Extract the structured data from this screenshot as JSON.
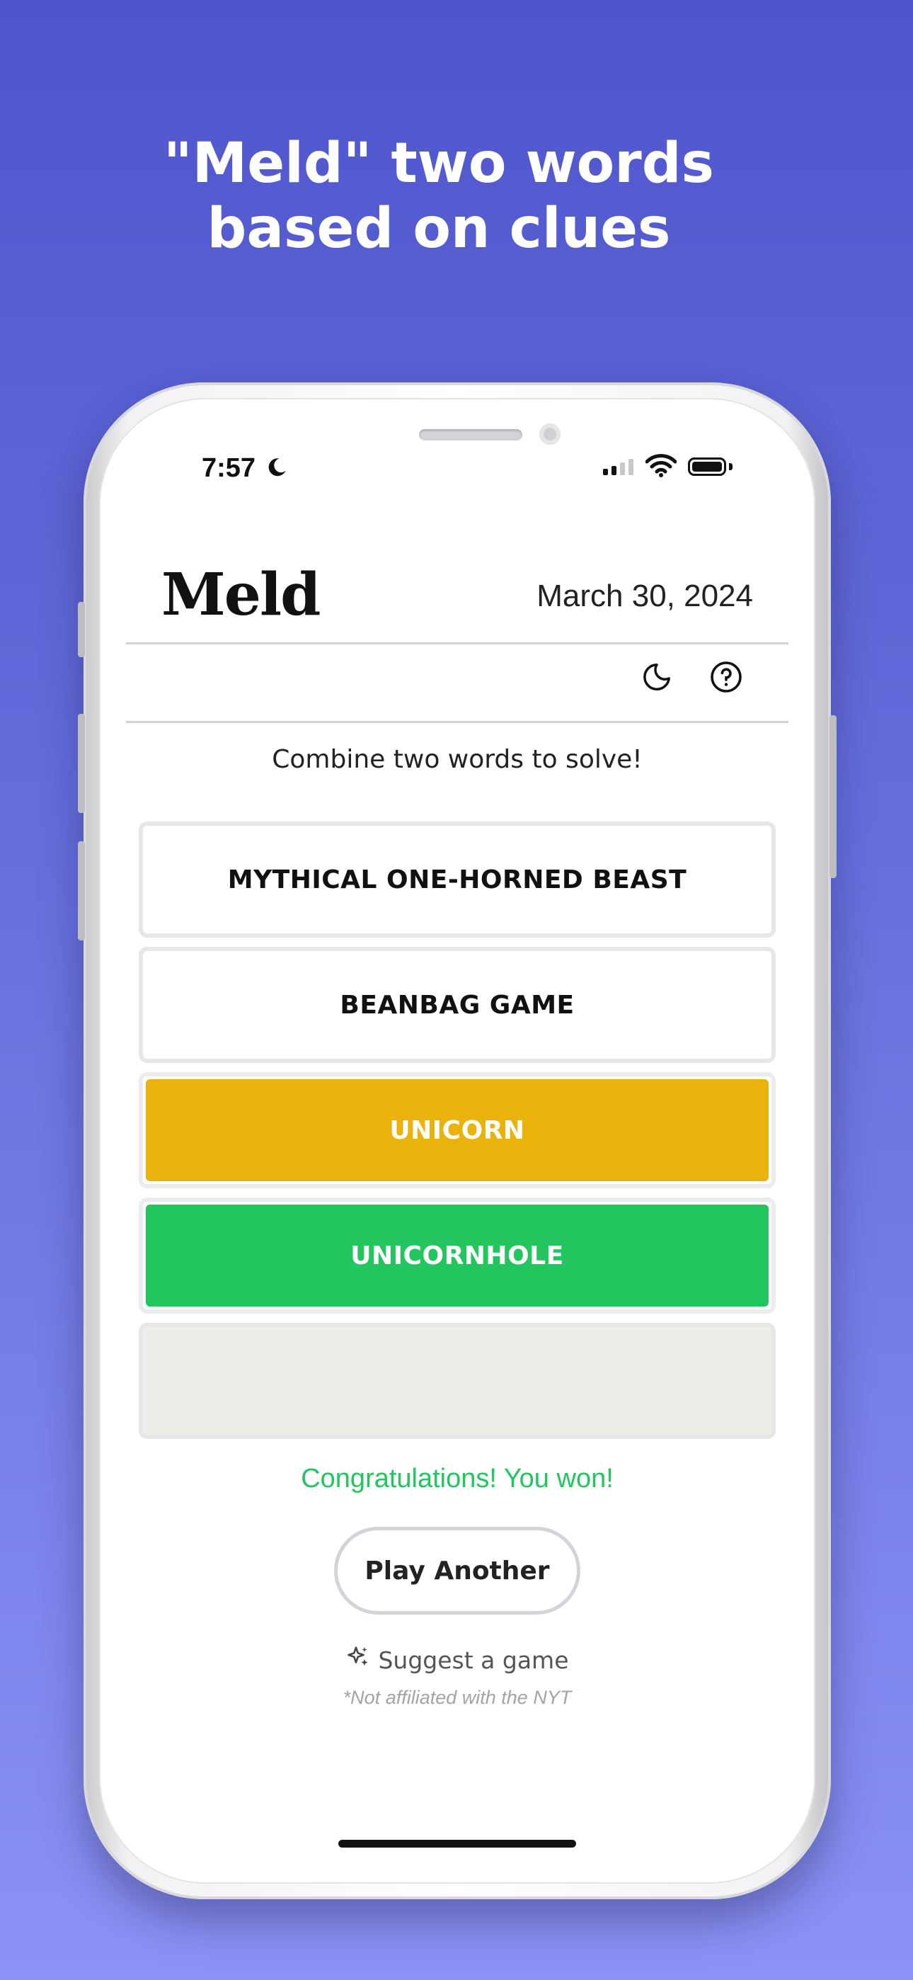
{
  "headline": {
    "line1": "\"Meld\" two words",
    "line2": "based on clues"
  },
  "status_bar": {
    "time": "7:57",
    "focus_icon": "moon-icon",
    "signal_icon": "cellular-signal-icon",
    "wifi_icon": "wifi-icon",
    "battery_icon": "battery-icon"
  },
  "app": {
    "logo": "Meld",
    "date": "March 30, 2024",
    "toolbar": {
      "dark_mode_icon": "moon-icon",
      "help_icon": "help-circle-icon"
    },
    "instruction": "Combine two words to solve!",
    "tiles": [
      {
        "text": "MYTHICAL ONE-HORNED BEAST",
        "state": "clue"
      },
      {
        "text": "BEANBAG GAME",
        "state": "clue"
      },
      {
        "text": "UNICORN",
        "state": "word",
        "color": "#e9b30c"
      },
      {
        "text": "UNICORNHOLE",
        "state": "solved",
        "color": "#22c55e"
      },
      {
        "text": "",
        "state": "empty",
        "color": "#eeede7"
      }
    ],
    "result_message": "Congratulations! You won!",
    "play_another_label": "Play Another",
    "suggest_label": "Suggest a game",
    "suggest_icon": "sparkles-icon",
    "disclaimer": "*Not affiliated with the NYT"
  }
}
